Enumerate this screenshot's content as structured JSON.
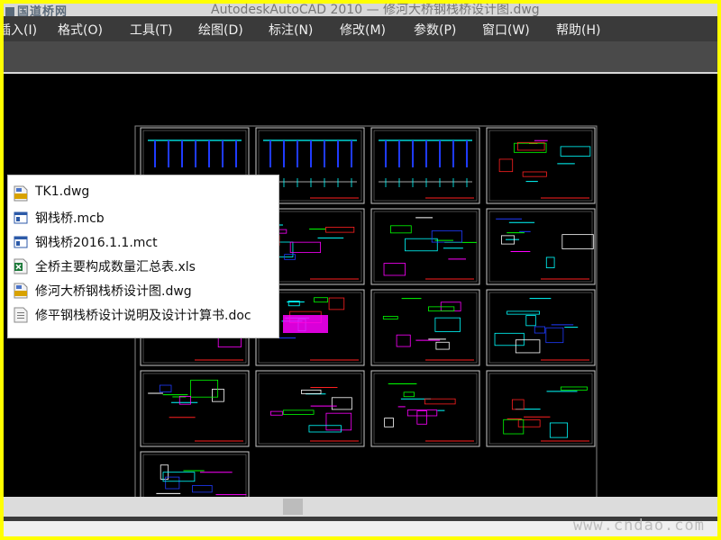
{
  "watermark_top": "国道桥网",
  "window_title": "AutodeskAutoCAD 2010 — 修河大桥钢栈桥设计图.dwg",
  "menu": [
    {
      "id": "insert",
      "label": "插入(I)"
    },
    {
      "id": "format",
      "label": "格式(O)"
    },
    {
      "id": "tools",
      "label": "工具(T)"
    },
    {
      "id": "draw",
      "label": "绘图(D)"
    },
    {
      "id": "dimension",
      "label": "标注(N)"
    },
    {
      "id": "modify",
      "label": "修改(M)"
    },
    {
      "id": "parameter",
      "label": "参数(P)"
    },
    {
      "id": "window",
      "label": "窗口(W)"
    },
    {
      "id": "help",
      "label": "帮助(H)"
    }
  ],
  "files": [
    {
      "name": "TK1.dwg",
      "icon": "dwg-file-icon"
    },
    {
      "name": "钢栈桥.mcb",
      "icon": "midas-file-icon"
    },
    {
      "name": "钢栈桥2016.1.1.mct",
      "icon": "midas-file-icon"
    },
    {
      "name": "全桥主要构成数量汇总表.xls",
      "icon": "excel-file-icon"
    },
    {
      "name": "修河大桥钢栈桥设计图.dwg",
      "icon": "dwg-file-icon"
    },
    {
      "name": "修平钢栈桥设计说明及设计计算书.doc",
      "icon": "word-file-icon"
    }
  ],
  "watermark_bottom": "www.cndao.com",
  "colors": {
    "border": "#ffff00",
    "menubar": "#3a3a3a",
    "canvas": "#000000",
    "sheet_frame": "#c8c8c8",
    "cad_cyan": "#00ffff",
    "cad_blue": "#1f3bff",
    "cad_magenta": "#ff00ff",
    "cad_red": "#ff2020",
    "cad_green": "#00ff00"
  }
}
